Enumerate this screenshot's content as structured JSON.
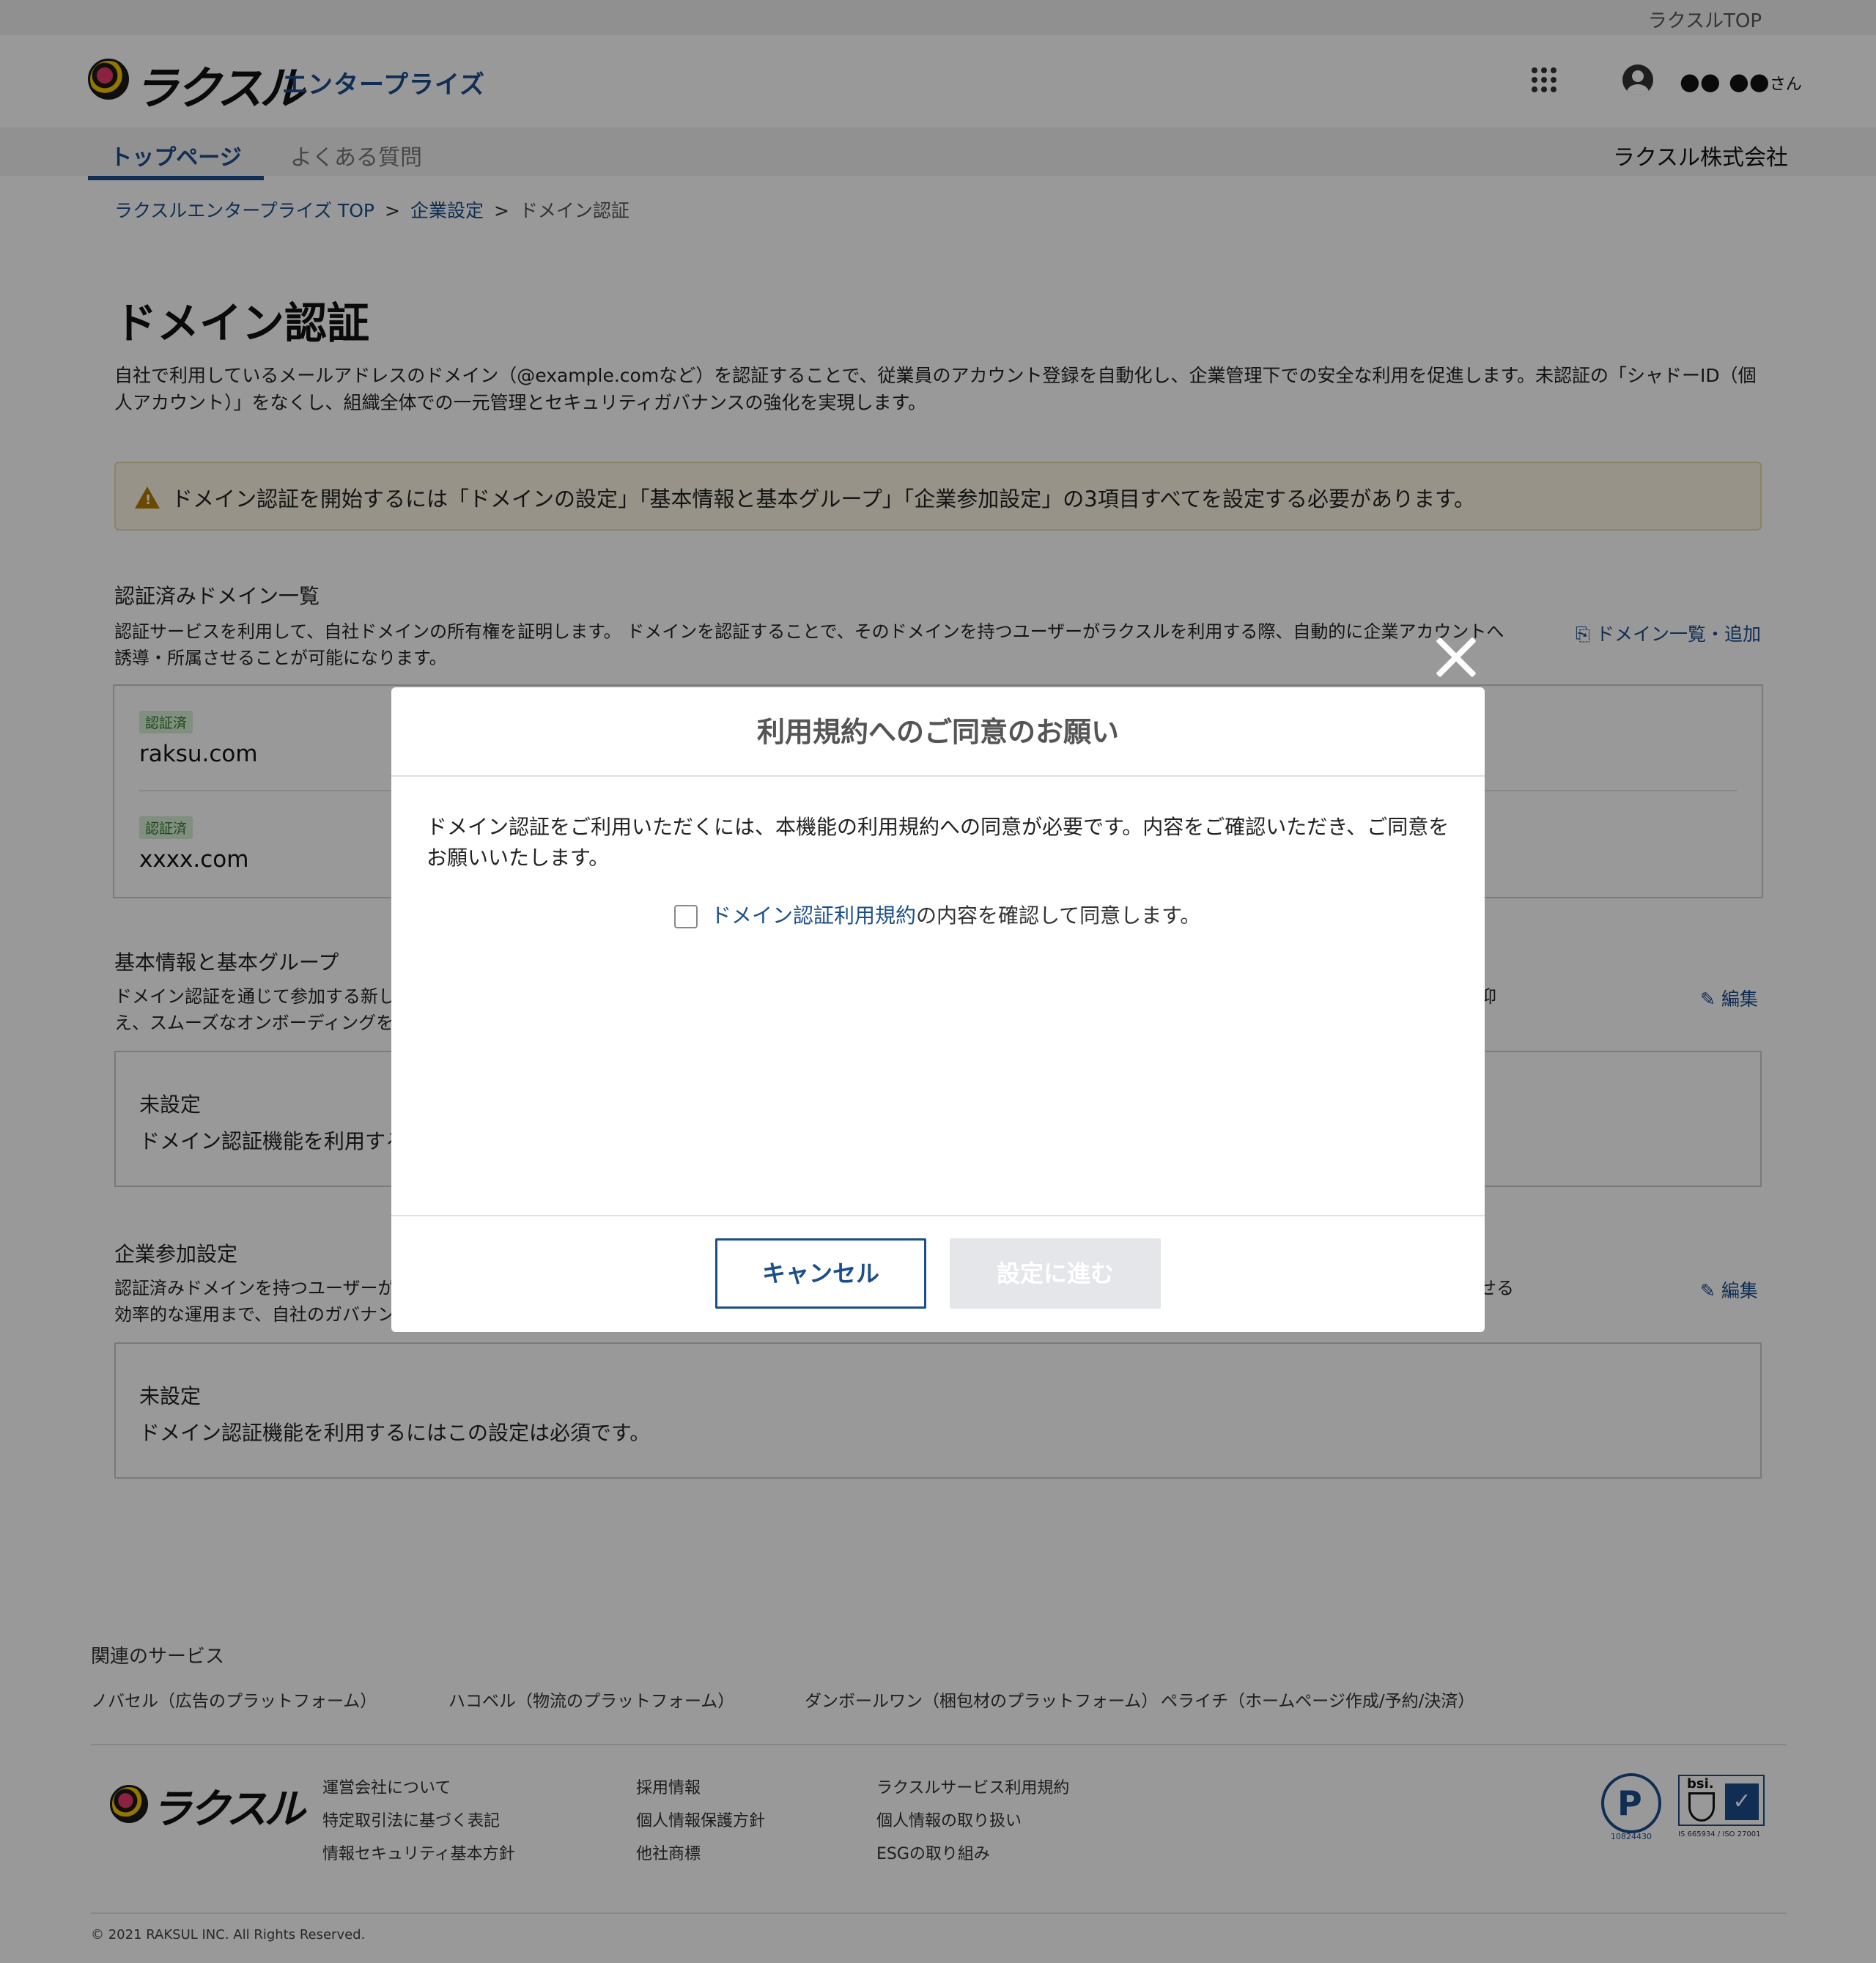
{
  "topbar": {
    "raksul_top": "ラクスルTOP"
  },
  "header": {
    "logo_text": "ラクスル",
    "product": "エンタープライズ",
    "user_name": "●● ●●",
    "user_suffix": "さん"
  },
  "nav": {
    "tabs": [
      {
        "label": "トップページ"
      },
      {
        "label": "よくある質問"
      }
    ],
    "company": "ラクスル株式会社"
  },
  "breadcrumb": {
    "items": [
      "ラクスルエンタープライズ TOP",
      "企業設定",
      "ドメイン認証"
    ],
    "separator": ">"
  },
  "page": {
    "title": "ドメイン認証",
    "intro": "自社で利用しているメールアドレスのドメイン（@example.comなど）を認証することで、従業員のアカウント登録を自動化し、企業管理下での安全な利用を促進します。未認証の「シャドーID（個人アカウント）」をなくし、組織全体での一元管理とセキュリティガバナンスの強化を実現します。",
    "warning": "ドメイン認証を開始するには「ドメインの設定」「基本情報と基本グループ」「企業参加設定」の3項目すべてを設定する必要があります。"
  },
  "verified_domains": {
    "title": "認証済みドメイン一覧",
    "desc": "認証サービスを利用して、自社ドメインの所有権を証明します。 ドメインを認証することで、そのドメインを持つユーザーがラクスルを利用する際、自動的に企業アカウントへ誘導・所属させることが可能になります。",
    "link": "ドメイン一覧・追加",
    "items": [
      {
        "badge": "認証済",
        "domain": "raksu.com"
      },
      {
        "badge": "認証済",
        "domain": "xxxx.com"
      }
    ]
  },
  "basic_info": {
    "title": "基本情報と基本グループ",
    "desc_line1": "ドメイン認証を通じて参加する新し",
    "desc_line1_end": "に抑",
    "desc_line2": "え、スムーズなオンボーディングを",
    "link": "編集",
    "status": "未設定",
    "note": "ドメイン認証機能を利用する"
  },
  "company_join": {
    "title": "企業参加設定",
    "desc_line1": "認証済みドメインを持つユーザーが",
    "desc_line1_end": "せる",
    "desc_line2": "効率的な運用まで、自社のガバナン",
    "link": "編集",
    "status": "未設定",
    "note": "ドメイン認証機能を利用するにはこの設定は必須です。"
  },
  "modal": {
    "title": "利用規約へのご同意のお願い",
    "body": "ドメイン認証をご利用いただくには、本機能の利用規約への同意が必要です。内容をご確認いただき、ご同意をお願いいたします。",
    "agree_link": "ドメイン認証利用規約",
    "agree_text": "の内容を確認して同意します。",
    "cancel": "キャンセル",
    "next": "設定に進む"
  },
  "footer": {
    "related_title": "関連のサービス",
    "services": [
      "ノバセル（広告のプラットフォーム）",
      "ハコベル（物流のプラットフォーム）",
      "ダンボールワン（梱包材のプラットフォーム）",
      "ペライチ（ホームページ作成/予約/決済）"
    ],
    "logo_text": "ラクスル",
    "links_col1": [
      "運営会社について",
      "特定取引法に基づく表記",
      "情報セキュリティ基本方針"
    ],
    "links_col2": [
      "採用情報",
      "個人情報保護方針",
      "他社商標"
    ],
    "links_col3": [
      "ラクスルサービス利用規約",
      "個人情報の取り扱い",
      "ESGの取り組み"
    ],
    "pmark_number": "10824430",
    "iso_text": "IS 665934 / ISO 27001",
    "copyright": "© 2021 RAKSUL INC. All Rights Reserved."
  }
}
